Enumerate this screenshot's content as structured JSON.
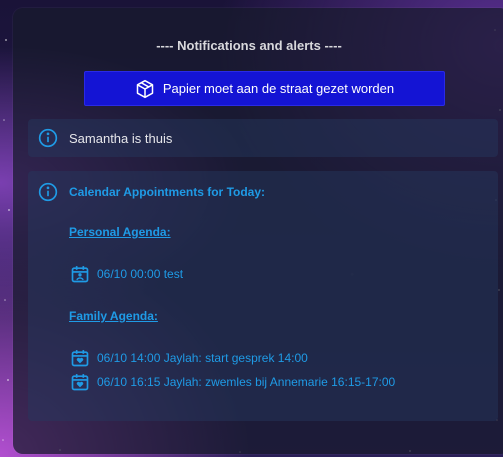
{
  "notifications": {
    "heading": "---- Notifications and alerts ----",
    "alert_button_label": "Papier moet aan de straat gezet worden",
    "alert_icon": "package-icon",
    "info_items": [
      {
        "icon": "info-icon",
        "text": "Samantha is thuis"
      }
    ],
    "calendar": {
      "icon": "info-icon",
      "title": "Calendar Appointments for Today:",
      "personal": {
        "label": "Personal Agenda:",
        "events": [
          {
            "icon": "calendar-account-icon",
            "text": "06/10 00:00 test"
          }
        ]
      },
      "family": {
        "label": "Family Agenda:",
        "events": [
          {
            "icon": "calendar-heart-icon",
            "text": "06/10 14:00 Jaylah: start gesprek 14:00"
          },
          {
            "icon": "calendar-heart-icon",
            "text": "06/10 16:15 Jaylah: zwemles bij Annemarie 16:15-17:00"
          }
        ]
      }
    }
  },
  "colors": {
    "accent_blue": "#1f9be6",
    "button_blue": "#1414d4",
    "heading_text": "#d8d8dc"
  }
}
